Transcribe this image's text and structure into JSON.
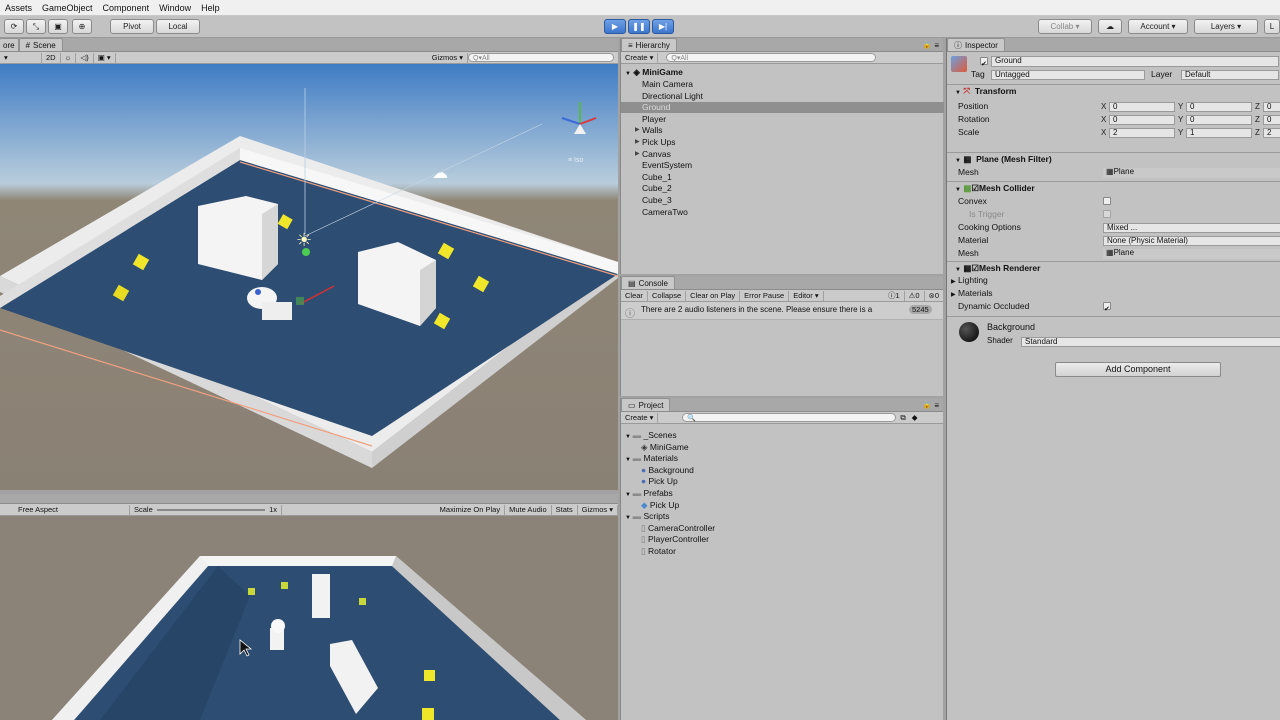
{
  "menubar": {
    "items": [
      "Assets",
      "GameObject",
      "Component",
      "Window",
      "Help"
    ]
  },
  "toolbar": {
    "pivot_label": "Pivot",
    "local_label": "Local",
    "collab_label": "Collab",
    "account_label": "Account",
    "layers_label": "Layers",
    "layout_label": "L"
  },
  "scene": {
    "tab_partial": "ore",
    "tab_label": "Scene",
    "mode_2d": "2D",
    "gizmos_label": "Gizmos",
    "search_placeholder": "Q▾All",
    "persp_label": "≡ Iso"
  },
  "game": {
    "aspect_label": "Free Aspect",
    "scale_label": "Scale",
    "scale_value": "1x",
    "maximize_label": "Maximize On Play",
    "mute_label": "Mute Audio",
    "stats_label": "Stats",
    "gizmos_label": "Gizmos"
  },
  "hierarchy": {
    "tab_label": "Hierarchy",
    "create_label": "Create",
    "search_placeholder": "Q▾All",
    "scene_name": "MiniGame",
    "items": [
      {
        "label": "Main Camera",
        "expandable": false,
        "selected": false
      },
      {
        "label": "Directional Light",
        "expandable": false,
        "selected": false
      },
      {
        "label": "Ground",
        "expandable": false,
        "selected": true
      },
      {
        "label": "Player",
        "expandable": false,
        "selected": false
      },
      {
        "label": "Walls",
        "expandable": true,
        "selected": false
      },
      {
        "label": "Pick Ups",
        "expandable": true,
        "selected": false
      },
      {
        "label": "Canvas",
        "expandable": true,
        "selected": false
      },
      {
        "label": "EventSystem",
        "expandable": false,
        "selected": false
      },
      {
        "label": "Cube_1",
        "expandable": false,
        "selected": false
      },
      {
        "label": "Cube_2",
        "expandable": false,
        "selected": false
      },
      {
        "label": "Cube_3",
        "expandable": false,
        "selected": false
      },
      {
        "label": "CameraTwo",
        "expandable": false,
        "selected": false
      }
    ]
  },
  "console": {
    "tab_label": "Console",
    "buttons": [
      "Clear",
      "Collapse",
      "Clear on Play",
      "Error Pause",
      "Editor"
    ],
    "count_info": "1",
    "count_warn": "0",
    "count_error": "0",
    "message": "There are 2 audio listeners in the scene. Please ensure there is a",
    "message_count": "5245"
  },
  "project": {
    "tab_label": "Project",
    "create_label": "Create",
    "tree": [
      {
        "label": "_Scenes",
        "type": "folder",
        "level": 0
      },
      {
        "label": "MiniGame",
        "type": "scene",
        "level": 1
      },
      {
        "label": "Materials",
        "type": "folder",
        "level": 0
      },
      {
        "label": "Background",
        "type": "material",
        "level": 1
      },
      {
        "label": "Pick Up",
        "type": "material",
        "level": 1
      },
      {
        "label": "Prefabs",
        "type": "folder",
        "level": 0
      },
      {
        "label": "Pick Up",
        "type": "prefab",
        "level": 1
      },
      {
        "label": "Scripts",
        "type": "folder",
        "level": 0
      },
      {
        "label": "CameraController",
        "type": "script",
        "level": 1
      },
      {
        "label": "PlayerController",
        "type": "script",
        "level": 1
      },
      {
        "label": "Rotator",
        "type": "script",
        "level": 1
      }
    ]
  },
  "inspector": {
    "tab_label": "Inspector",
    "object_name": "Ground",
    "tag_label": "Tag",
    "tag_value": "Untagged",
    "layer_label": "Layer",
    "layer_value": "Default",
    "transform": {
      "title": "Transform",
      "position_label": "Position",
      "rotation_label": "Rotation",
      "scale_label": "Scale",
      "axis_x": "X",
      "axis_y": "Y",
      "axis_z": "Z",
      "position": [
        "0",
        "0",
        "0"
      ],
      "rotation": [
        "0",
        "0",
        "0"
      ],
      "scale": [
        "2",
        "1",
        "2"
      ]
    },
    "mesh_filter": {
      "title": "Plane (Mesh Filter)",
      "mesh_label": "Mesh",
      "mesh_value": "Plane"
    },
    "mesh_collider": {
      "title": "Mesh Collider",
      "convex_label": "Convex",
      "trigger_label": "Is Trigger",
      "cooking_label": "Cooking Options",
      "cooking_value": "Mixed ...",
      "material_label": "Material",
      "material_value": "None (Physic Material)",
      "mesh_label": "Mesh",
      "mesh_value": "Plane"
    },
    "mesh_renderer": {
      "title": "Mesh Renderer",
      "lighting_label": "Lighting",
      "materials_label": "Materials",
      "dynamic_label": "Dynamic Occluded"
    },
    "material": {
      "name": "Background",
      "shader_label": "Shader",
      "shader_value": "Standard"
    },
    "add_component_label": "Add Component"
  },
  "colors": {
    "ground": "#2e4d72",
    "sky_top": "#4e86c6",
    "wall": "#f2f2f2",
    "pickup": "#f0e62a",
    "play_active": "#4a82d8"
  },
  "icons": [
    "move-tool-icon",
    "scale-tool-icon",
    "rect-tool-icon",
    "transform-tool-icon",
    "play-icon",
    "pause-icon",
    "step-icon",
    "cloud-icon",
    "lock-icon",
    "menu-icon",
    "gameobject-cube-icon",
    "folder-icon",
    "material-sphere-icon",
    "prefab-cube-icon",
    "script-icon",
    "info-icon",
    "warning-icon",
    "error-icon",
    "unity-scene-icon",
    "light-sun-icon",
    "cloud-gizmo-icon",
    "scene-gizmo-axes-icon",
    "mouse-cursor-icon"
  ]
}
